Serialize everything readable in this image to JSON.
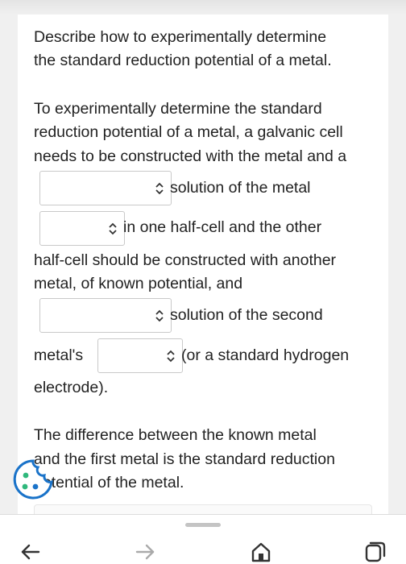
{
  "question": {
    "line1": "Describe how to experimentally determine",
    "line2": "the standard reduction potential of a metal."
  },
  "answer": {
    "l1": "To experimentally determine the standard",
    "l2": "reduction potential of a metal, a galvanic cell",
    "l3": "needs to be constructed with the metal and a",
    "after_select1": "solution of the metal",
    "after_select2": "in one half-cell and the other",
    "l6": "half-cell should be constructed with another",
    "l7": "metal, of known potential, and",
    "after_select3": "solution of the second",
    "before_select4": "metal's",
    "after_select4": "(or a standard hydrogen",
    "l10": "electrode)."
  },
  "conclusion": {
    "l1": "The difference between the known metal",
    "l2": "and the first metal is the standard reduction",
    "l3": "potential of the metal."
  },
  "selects": {
    "s1_value": "",
    "s2_value": "",
    "s3_value": "",
    "s4_value": ""
  },
  "icons": {
    "caret": "up-down-chevron-icon",
    "back": "arrow-left-icon",
    "forward": "arrow-right-icon",
    "home": "home-icon",
    "tabs": "tabs-icon",
    "cookie": "cookie-icon"
  },
  "colors": {
    "cookie_blue": "#1a73c9",
    "cookie_green": "#2fb87c"
  }
}
